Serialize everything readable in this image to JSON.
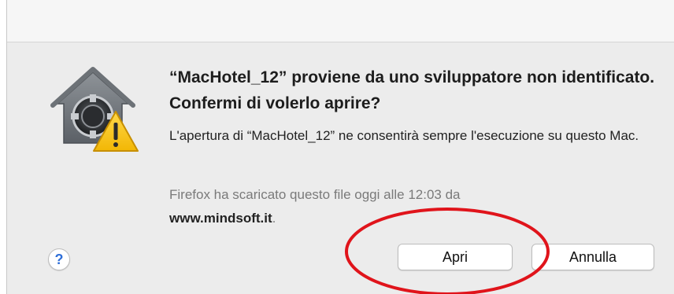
{
  "dialog": {
    "headline": "“MacHotel_12” proviene da uno sviluppatore non identificato. Confermi di volerlo aprire?",
    "message": "L'apertura di “MacHotel_12” ne consentirà sempre l'esecuzione su questo Mac.",
    "download_info_prefix": "Firefox ha scaricato questo file oggi alle 12:03 da",
    "download_host": "www.mindsoft.it",
    "download_info_suffix": ".",
    "icon": "gatekeeper-warning-icon"
  },
  "buttons": {
    "help_label": "?",
    "open_label": "Apri",
    "cancel_label": "Annulla"
  },
  "annotation": {
    "color": "#e0141b"
  },
  "colors": {
    "dialog_background": "#ececec",
    "help_accent": "#2f6fd8",
    "warning_yellow": "#f4c20d"
  }
}
